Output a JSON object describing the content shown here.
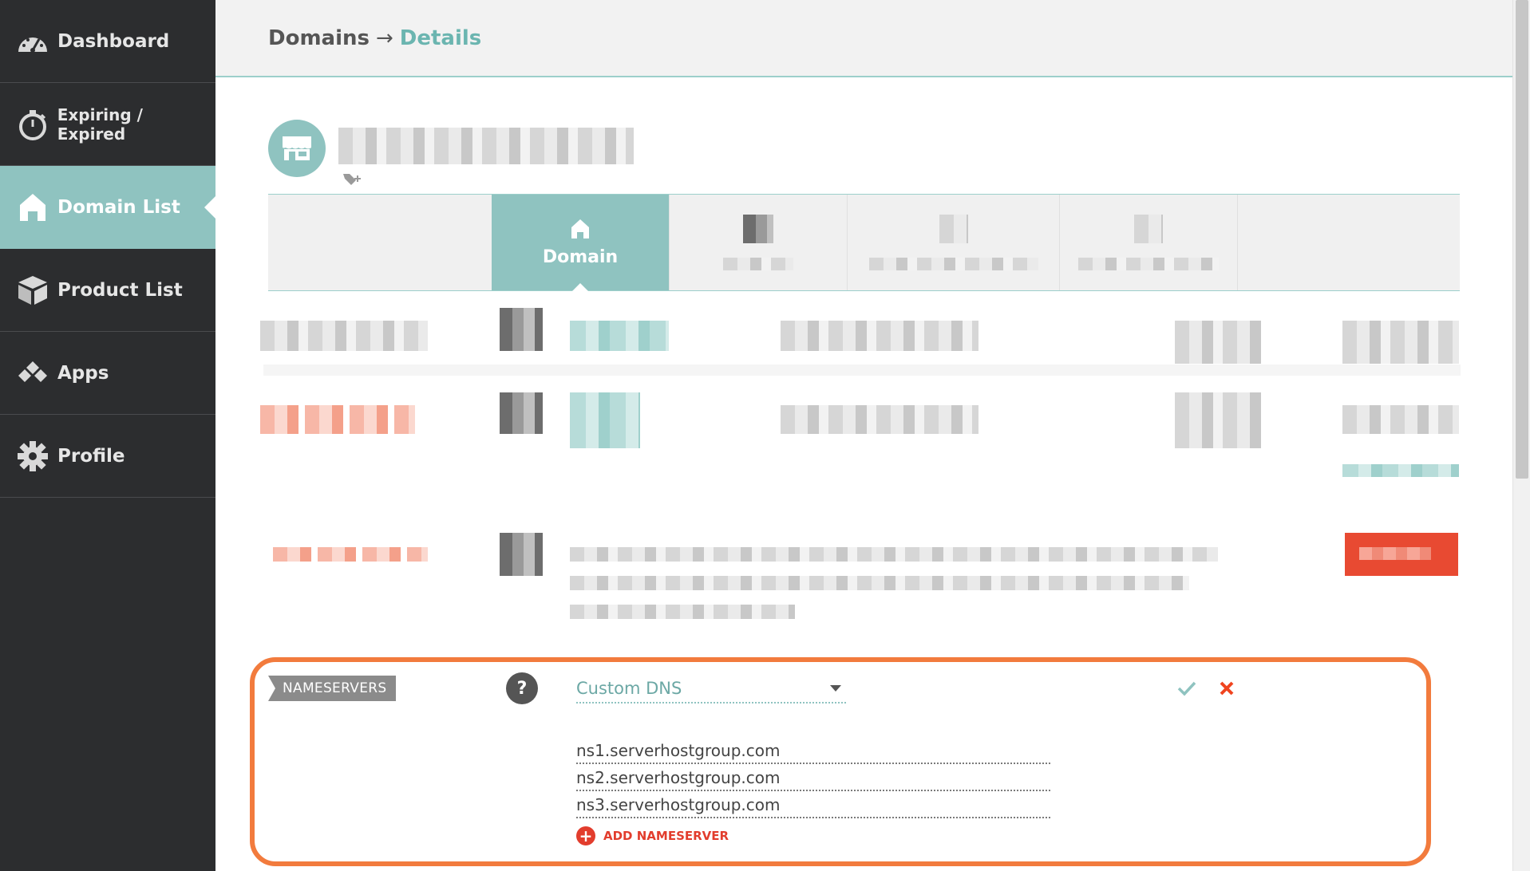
{
  "sidebar": {
    "items": [
      {
        "label": "Dashboard",
        "icon": "dashboard-gauge-icon"
      },
      {
        "label": "Expiring / Expired",
        "icon": "stopwatch-icon"
      },
      {
        "label": "Domain List",
        "icon": "home-icon",
        "active": true
      },
      {
        "label": "Product List",
        "icon": "box-icon"
      },
      {
        "label": "Apps",
        "icon": "apps-diamonds-icon"
      },
      {
        "label": "Profile",
        "icon": "gear-icon"
      }
    ]
  },
  "header": {
    "breadcrumb_root": "Domains",
    "breadcrumb_arrow": "→",
    "breadcrumb_current": "Details"
  },
  "tabs": {
    "active_label": "Domain"
  },
  "nameservers": {
    "label": "NAMESERVERS",
    "help": "?",
    "dns_mode": "Custom DNS",
    "entries": [
      "ns1.serverhostgroup.com",
      "ns2.serverhostgroup.com",
      "ns3.serverhostgroup.com"
    ],
    "add_label": "ADD NAMESERVER",
    "add_symbol": "+"
  },
  "colors": {
    "sidebar_bg": "#2c2d2f",
    "accent_teal": "#8fc3c0",
    "highlight_orange": "#f27b3d",
    "danger_red": "#e84a32"
  }
}
